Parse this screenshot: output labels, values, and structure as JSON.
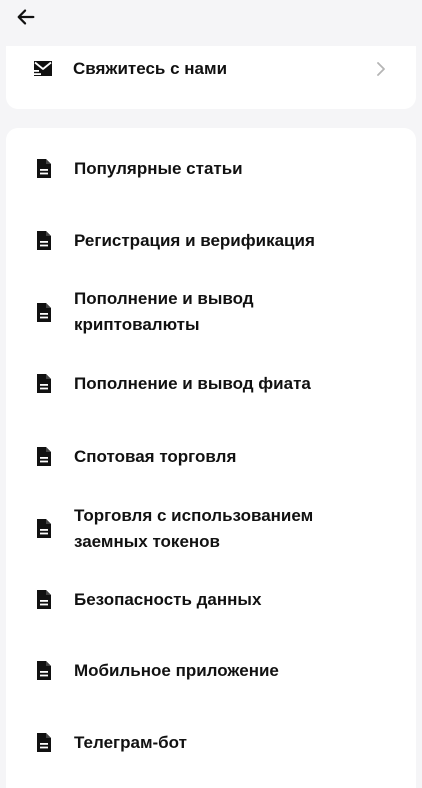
{
  "header": {
    "back_icon": "arrow-left-icon"
  },
  "contact": {
    "label": "Свяжитесь с нами",
    "icon": "mail-send-icon",
    "chevron_icon": "chevron-right-icon"
  },
  "topics": [
    {
      "label": "Популярные статьи",
      "icon": "document-icon"
    },
    {
      "label": "Регистрация и верификация",
      "icon": "document-icon"
    },
    {
      "label": "Пополнение и вывод криптовалюты",
      "icon": "document-icon"
    },
    {
      "label": "Пополнение и вывод фиата",
      "icon": "document-icon"
    },
    {
      "label": "Спотовая торговля",
      "icon": "document-icon"
    },
    {
      "label": "Торговля с использованием заемных токенов",
      "icon": "document-icon"
    },
    {
      "label": "Безопасность данных",
      "icon": "document-icon"
    },
    {
      "label": "Мобильное приложение",
      "icon": "document-icon"
    },
    {
      "label": "Телеграм-бот",
      "icon": "document-icon"
    }
  ],
  "colors": {
    "background": "#f5f5f7",
    "card": "#ffffff",
    "text": "#111111",
    "chevron": "#b5b5b5"
  }
}
